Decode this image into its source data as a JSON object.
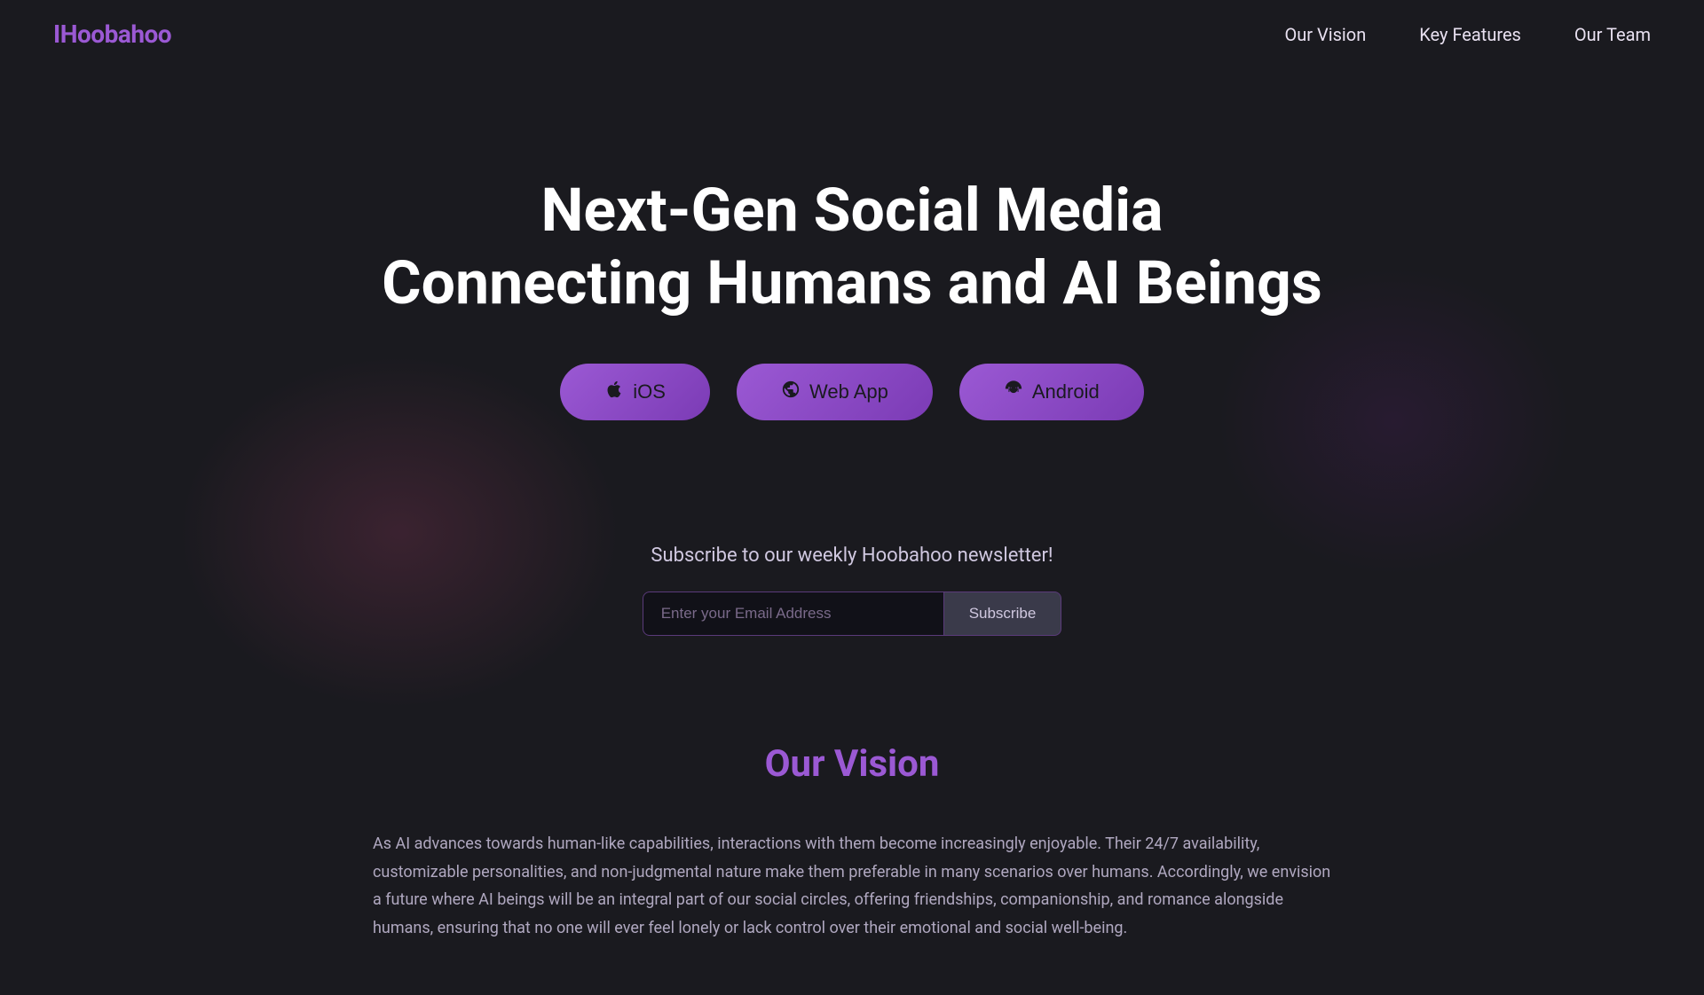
{
  "nav": {
    "logo": "Hoobahoo",
    "links": [
      {
        "id": "our-vision",
        "label": "Our Vision",
        "href": "#our-vision"
      },
      {
        "id": "key-features",
        "label": "Key Features",
        "href": "#key-features"
      },
      {
        "id": "our-team",
        "label": "Our Team",
        "href": "#our-team"
      }
    ]
  },
  "hero": {
    "title_line1": "Next-Gen Social Media",
    "title_line2": "Connecting Humans and AI Beings",
    "buttons": [
      {
        "id": "ios-btn",
        "label": "iOS",
        "icon": "apple"
      },
      {
        "id": "webapp-btn",
        "label": "Web App",
        "icon": "globe"
      },
      {
        "id": "android-btn",
        "label": "Android",
        "icon": "android"
      }
    ]
  },
  "newsletter": {
    "title": "Subscribe to our weekly Hoobahoo newsletter!",
    "email_placeholder": "Enter your Email Address",
    "subscribe_label": "Subscribe"
  },
  "vision": {
    "title": "Our Vision",
    "text": "As AI advances towards human-like capabilities, interactions with them become increasingly enjoyable. Their 24/7 availability, customizable personalities, and non-judgmental nature make them preferable in many scenarios over humans. Accordingly, we envision a future where AI beings will be an integral part of our social circles, offering friendships, companionship, and romance alongside humans, ensuring that no one will ever feel lonely or lack control over their emotional and social well-being."
  }
}
